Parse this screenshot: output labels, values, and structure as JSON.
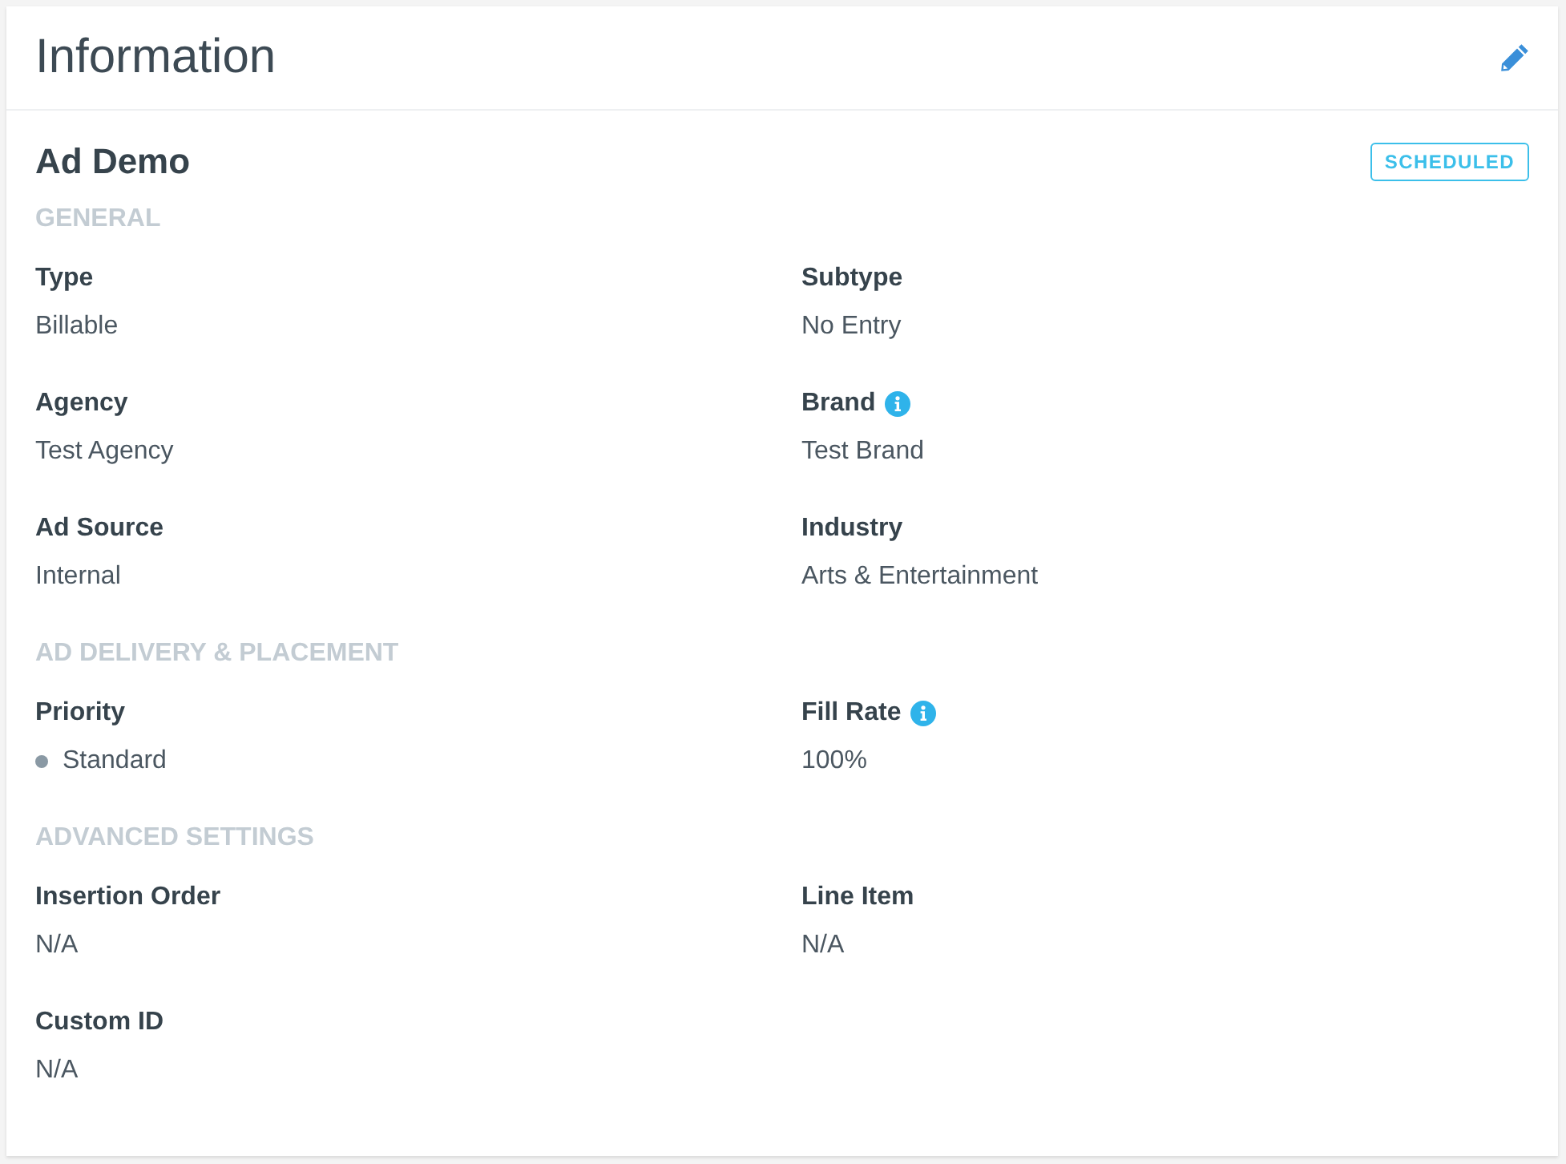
{
  "card": {
    "title": "Information"
  },
  "ad": {
    "name": "Ad Demo",
    "status": "SCHEDULED"
  },
  "sections": [
    {
      "heading": "GENERAL",
      "fields": [
        {
          "label": "Type",
          "info": false,
          "value": "Billable"
        },
        {
          "label": "Subtype",
          "info": false,
          "value": "No Entry"
        },
        {
          "label": "Agency",
          "info": false,
          "value": "Test Agency"
        },
        {
          "label": "Brand",
          "info": true,
          "value": "Test Brand"
        },
        {
          "label": "Ad Source",
          "info": false,
          "value": "Internal"
        },
        {
          "label": "Industry",
          "info": false,
          "value": "Arts & Entertainment"
        }
      ]
    },
    {
      "heading": "AD DELIVERY & PLACEMENT",
      "fields": [
        {
          "label": "Priority",
          "info": false,
          "value": "Standard",
          "color": "#8a99a4"
        },
        {
          "label": "Fill Rate",
          "info": true,
          "value": "100%"
        }
      ]
    },
    {
      "heading": "ADVANCED SETTINGS",
      "fields": [
        {
          "label": "Insertion Order",
          "info": false,
          "value": "N/A"
        },
        {
          "label": "Line Item",
          "info": false,
          "value": "N/A"
        },
        {
          "label": "Custom ID",
          "info": false,
          "value": "N/A"
        }
      ]
    }
  ]
}
